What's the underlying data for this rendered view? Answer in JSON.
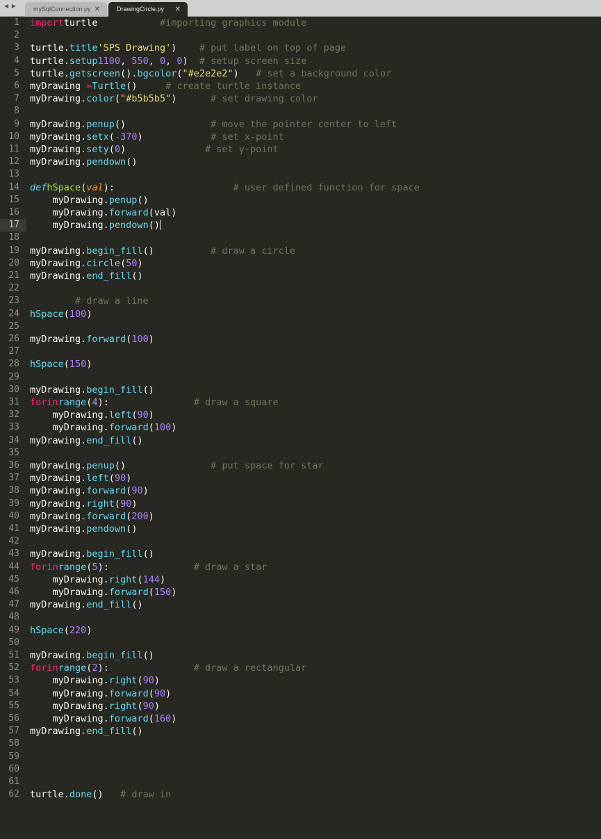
{
  "tabs": [
    {
      "label": "mySqlConnection.py",
      "active": false
    },
    {
      "label": "DrawingCircle.py",
      "active": true
    }
  ],
  "nav_arrows": "◀ ▶",
  "close_glyph": "✕",
  "current_line": 17,
  "lines": [
    [
      [
        "k",
        "import"
      ],
      [
        "",
        "turtle           "
      ],
      [
        "c",
        "#importing graphics module"
      ]
    ],
    [],
    [
      [
        "",
        "turtle."
      ],
      [
        "m",
        "title"
      ],
      [
        "",
        ""
      ],
      [
        "s",
        "'SPS Drawing'"
      ],
      [
        "",
        ")    "
      ],
      [
        "c",
        "# put label on top of page"
      ]
    ],
    [
      [
        "",
        "turtle."
      ],
      [
        "m",
        "setup"
      ],
      [
        "",
        ""
      ],
      [
        "n",
        "1100"
      ],
      [
        "",
        ", "
      ],
      [
        "n",
        "550"
      ],
      [
        "",
        ", "
      ],
      [
        "n",
        "0"
      ],
      [
        "",
        ", "
      ],
      [
        "n",
        "0"
      ],
      [
        "",
        ")  "
      ],
      [
        "c",
        "# setup screen size"
      ]
    ],
    [
      [
        "",
        "turtle."
      ],
      [
        "m",
        "getscreen"
      ],
      [
        "",
        "()."
      ],
      [
        "m",
        "bgcolor"
      ],
      [
        "",
        "("
      ],
      [
        "s",
        "\"#e2e2e2\""
      ],
      [
        "",
        ")   "
      ],
      [
        "c",
        "# set a background color"
      ]
    ],
    [
      [
        "",
        "myDrawing "
      ],
      [
        "k",
        "="
      ],
      [
        "",
        ""
      ],
      [
        "m",
        "Turtle"
      ],
      [
        "",
        "()     "
      ],
      [
        "c",
        "# create turtle instance"
      ]
    ],
    [
      [
        "",
        "myDrawing."
      ],
      [
        "m",
        "color"
      ],
      [
        "",
        "("
      ],
      [
        "s",
        "\"#b5b5b5\""
      ],
      [
        "",
        ")      "
      ],
      [
        "c",
        "# set drawing color"
      ]
    ],
    [],
    [
      [
        "",
        "myDrawing."
      ],
      [
        "m",
        "penup"
      ],
      [
        "",
        "()               "
      ],
      [
        "c",
        "# move the pointer center to left"
      ]
    ],
    [
      [
        "",
        "myDrawing."
      ],
      [
        "m",
        "setx"
      ],
      [
        "",
        "("
      ],
      [
        "k",
        "-"
      ],
      [
        "n",
        "370"
      ],
      [
        "",
        ")            "
      ],
      [
        "c",
        "# set x-point"
      ]
    ],
    [
      [
        "",
        "myDrawing."
      ],
      [
        "m",
        "sety"
      ],
      [
        "",
        "("
      ],
      [
        "n",
        "0"
      ],
      [
        "",
        ")              "
      ],
      [
        "c",
        "# set y-point"
      ]
    ],
    [
      [
        "",
        "myDrawing."
      ],
      [
        "m",
        "pendown"
      ],
      [
        "",
        "()"
      ]
    ],
    [],
    [
      [
        "d",
        "def"
      ],
      [
        "",
        ""
      ],
      [
        "f",
        "hSpace"
      ],
      [
        "",
        "("
      ],
      [
        "p",
        "val"
      ],
      [
        "",
        "):                     "
      ],
      [
        "c",
        "# user defined function for space"
      ]
    ],
    [
      [
        "",
        "    myDrawing."
      ],
      [
        "m",
        "penup"
      ],
      [
        "",
        "()"
      ]
    ],
    [
      [
        "",
        "    myDrawing."
      ],
      [
        "m",
        "forward"
      ],
      [
        "",
        "(val)"
      ]
    ],
    [
      [
        "",
        "    myDrawing."
      ],
      [
        "m",
        "pendown"
      ],
      [
        "",
        "()"
      ]
    ],
    [],
    [
      [
        "",
        "myDrawing."
      ],
      [
        "m",
        "begin_fill"
      ],
      [
        "",
        "()          "
      ],
      [
        "c",
        "# draw a circle"
      ]
    ],
    [
      [
        "",
        "myDrawing."
      ],
      [
        "m",
        "circle"
      ],
      [
        "",
        "("
      ],
      [
        "n",
        "50"
      ],
      [
        "",
        ")"
      ]
    ],
    [
      [
        "",
        "myDrawing."
      ],
      [
        "m",
        "end_fill"
      ],
      [
        "",
        "()"
      ]
    ],
    [],
    [
      [
        "c",
        "        # draw a line"
      ]
    ],
    [
      [
        "m",
        "hSpace"
      ],
      [
        "",
        "("
      ],
      [
        "n",
        "100"
      ],
      [
        "",
        ")"
      ]
    ],
    [],
    [
      [
        "",
        "myDrawing."
      ],
      [
        "m",
        "forward"
      ],
      [
        "",
        "("
      ],
      [
        "n",
        "100"
      ],
      [
        "",
        ")"
      ]
    ],
    [],
    [
      [
        "m",
        "hSpace"
      ],
      [
        "",
        "("
      ],
      [
        "n",
        "150"
      ],
      [
        "",
        ")"
      ]
    ],
    [],
    [
      [
        "",
        "myDrawing."
      ],
      [
        "m",
        "begin_fill"
      ],
      [
        "",
        "()"
      ]
    ],
    [
      [
        "k",
        "for"
      ],
      [
        "",
        ""
      ],
      [
        "k",
        "in"
      ],
      [
        "",
        ""
      ],
      [
        "m",
        "range"
      ],
      [
        "",
        "("
      ],
      [
        "n",
        "4"
      ],
      [
        "",
        "):               "
      ],
      [
        "c",
        "# draw a square"
      ]
    ],
    [
      [
        "",
        "    myDrawing."
      ],
      [
        "m",
        "left"
      ],
      [
        "",
        "("
      ],
      [
        "n",
        "90"
      ],
      [
        "",
        ")"
      ]
    ],
    [
      [
        "",
        "    myDrawing."
      ],
      [
        "m",
        "forward"
      ],
      [
        "",
        "("
      ],
      [
        "n",
        "100"
      ],
      [
        "",
        ")"
      ]
    ],
    [
      [
        "",
        "myDrawing."
      ],
      [
        "m",
        "end_fill"
      ],
      [
        "",
        "()"
      ]
    ],
    [],
    [
      [
        "",
        "myDrawing."
      ],
      [
        "m",
        "penup"
      ],
      [
        "",
        "()               "
      ],
      [
        "c",
        "# put space for star"
      ]
    ],
    [
      [
        "",
        "myDrawing."
      ],
      [
        "m",
        "left"
      ],
      [
        "",
        "("
      ],
      [
        "n",
        "90"
      ],
      [
        "",
        ")"
      ]
    ],
    [
      [
        "",
        "myDrawing."
      ],
      [
        "m",
        "forward"
      ],
      [
        "",
        "("
      ],
      [
        "n",
        "90"
      ],
      [
        "",
        ")"
      ]
    ],
    [
      [
        "",
        "myDrawing."
      ],
      [
        "m",
        "right"
      ],
      [
        "",
        "("
      ],
      [
        "n",
        "90"
      ],
      [
        "",
        ")"
      ]
    ],
    [
      [
        "",
        "myDrawing."
      ],
      [
        "m",
        "forward"
      ],
      [
        "",
        "("
      ],
      [
        "n",
        "200"
      ],
      [
        "",
        ")"
      ]
    ],
    [
      [
        "",
        "myDrawing."
      ],
      [
        "m",
        "pendown"
      ],
      [
        "",
        "()"
      ]
    ],
    [],
    [
      [
        "",
        "myDrawing."
      ],
      [
        "m",
        "begin_fill"
      ],
      [
        "",
        "()"
      ]
    ],
    [
      [
        "k",
        "for"
      ],
      [
        "",
        ""
      ],
      [
        "k",
        "in"
      ],
      [
        "",
        ""
      ],
      [
        "m",
        "range"
      ],
      [
        "",
        "("
      ],
      [
        "n",
        "5"
      ],
      [
        "",
        "):               "
      ],
      [
        "c",
        "# draw a star"
      ]
    ],
    [
      [
        "",
        "    myDrawing."
      ],
      [
        "m",
        "right"
      ],
      [
        "",
        "("
      ],
      [
        "n",
        "144"
      ],
      [
        "",
        ")"
      ]
    ],
    [
      [
        "",
        "    myDrawing."
      ],
      [
        "m",
        "forward"
      ],
      [
        "",
        "("
      ],
      [
        "n",
        "150"
      ],
      [
        "",
        ")"
      ]
    ],
    [
      [
        "",
        "myDrawing."
      ],
      [
        "m",
        "end_fill"
      ],
      [
        "",
        "()"
      ]
    ],
    [],
    [
      [
        "m",
        "hSpace"
      ],
      [
        "",
        "("
      ],
      [
        "n",
        "220"
      ],
      [
        "",
        ")"
      ]
    ],
    [],
    [
      [
        "",
        "myDrawing."
      ],
      [
        "m",
        "begin_fill"
      ],
      [
        "",
        "()"
      ]
    ],
    [
      [
        "k",
        "for"
      ],
      [
        "",
        ""
      ],
      [
        "k",
        "in"
      ],
      [
        "",
        ""
      ],
      [
        "m",
        "range"
      ],
      [
        "",
        "("
      ],
      [
        "n",
        "2"
      ],
      [
        "",
        "):               "
      ],
      [
        "c",
        "# draw a rectangular"
      ]
    ],
    [
      [
        "",
        "    myDrawing."
      ],
      [
        "m",
        "right"
      ],
      [
        "",
        "("
      ],
      [
        "n",
        "90"
      ],
      [
        "",
        ")"
      ]
    ],
    [
      [
        "",
        "    myDrawing."
      ],
      [
        "m",
        "forward"
      ],
      [
        "",
        "("
      ],
      [
        "n",
        "90"
      ],
      [
        "",
        ")"
      ]
    ],
    [
      [
        "",
        "    myDrawing."
      ],
      [
        "m",
        "right"
      ],
      [
        "",
        "("
      ],
      [
        "n",
        "90"
      ],
      [
        "",
        ")"
      ]
    ],
    [
      [
        "",
        "    myDrawing."
      ],
      [
        "m",
        "forward"
      ],
      [
        "",
        "("
      ],
      [
        "n",
        "160"
      ],
      [
        "",
        ")"
      ]
    ],
    [
      [
        "",
        "myDrawing."
      ],
      [
        "m",
        "end_fill"
      ],
      [
        "",
        "()"
      ]
    ],
    [],
    [],
    [],
    [],
    [
      [
        "",
        "turtle."
      ],
      [
        "m",
        "done"
      ],
      [
        "",
        "()   "
      ],
      [
        "c",
        "# draw in"
      ]
    ]
  ]
}
